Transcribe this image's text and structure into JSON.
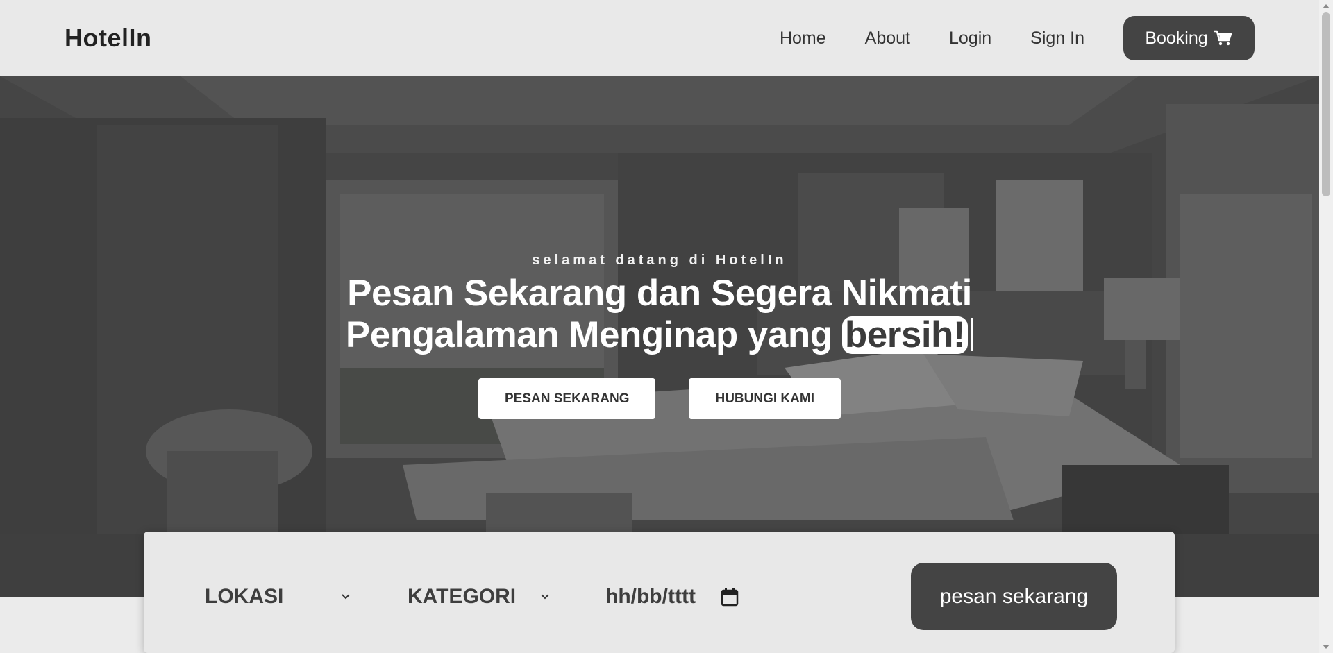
{
  "brand": {
    "name": "HotelIn"
  },
  "nav": {
    "links": [
      "Home",
      "About",
      "Login",
      "Sign In"
    ],
    "booking_label": "Booking",
    "booking_icon": "cart-icon"
  },
  "hero": {
    "subtitle": "selamat datang di HotelIn",
    "title_line1": "Pesan Sekarang dan Segera Nikmati",
    "title_line2": "Pengalaman Menginap yang",
    "highlight_word": "bersih!",
    "btn_order": "PESAN SEKARANG",
    "btn_contact": "HUBUNGI KAMI"
  },
  "search": {
    "location_label": "LOKASI",
    "category_label": "KATEGORI",
    "date_placeholder": "hh/bb/tttt",
    "submit_label": "pesan sekarang"
  },
  "colors": {
    "dark": "#444444",
    "navbar_bg": "#e9e9e9",
    "search_bg": "#e8e8e8"
  }
}
